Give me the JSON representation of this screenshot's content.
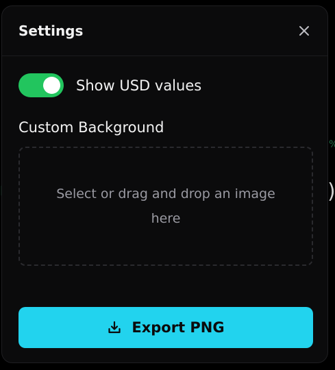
{
  "modal": {
    "title": "Settings",
    "close_icon": "close-icon"
  },
  "toggle": {
    "label": "Show USD values",
    "enabled": true,
    "accent": "#22c55e"
  },
  "custom_background": {
    "label": "Custom Background",
    "dropzone_text": "Select or drag and drop an image here"
  },
  "export": {
    "label": "Export PNG",
    "icon": "download-icon",
    "color": "#22d3ee"
  }
}
